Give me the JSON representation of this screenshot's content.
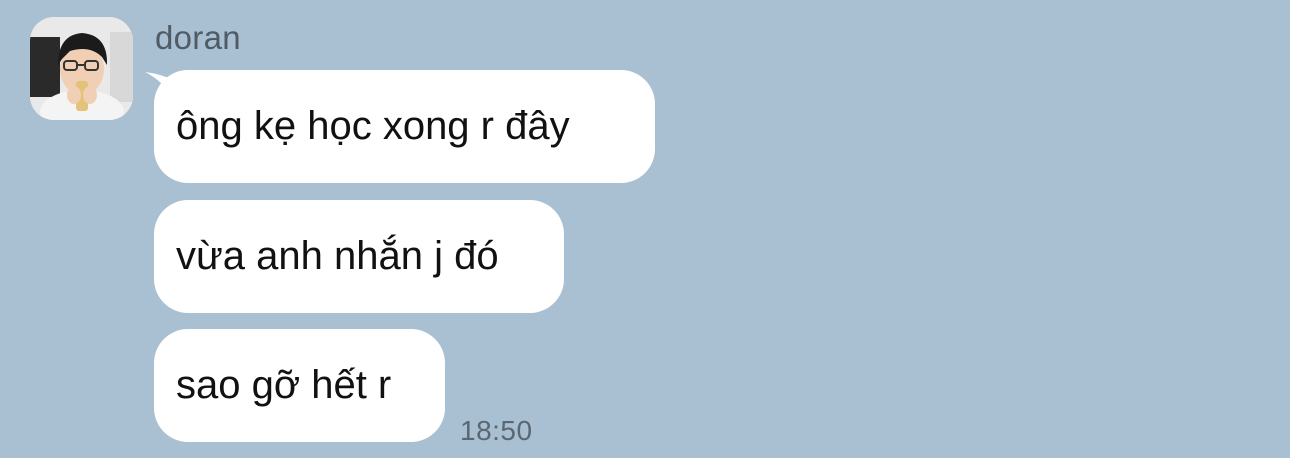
{
  "chat": {
    "sender_name": "doran",
    "messages": [
      {
        "text": "ông kẹ học xong r đây"
      },
      {
        "text": "vừa anh nhắn j đó"
      },
      {
        "text": "sao gỡ hết r"
      }
    ],
    "timestamp": "18:50"
  },
  "colors": {
    "background": "#a9bfd2",
    "bubble": "#ffffff",
    "sender_text": "#4f5b65",
    "timestamp_text": "#5b6771"
  }
}
